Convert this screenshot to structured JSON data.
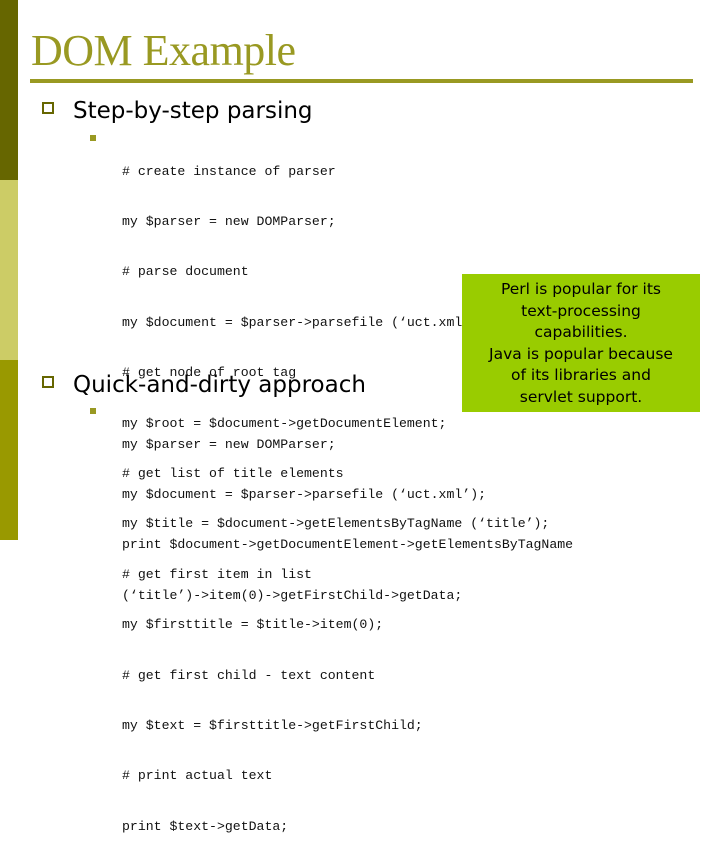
{
  "slide": {
    "title": "DOM Example",
    "colors": {
      "sidebar_top": "#666600",
      "sidebar_middle": "#cccc66",
      "sidebar_bottom": "#999900",
      "title": "#999922",
      "callout_bg": "#99cc00"
    },
    "sections": [
      {
        "heading": "Step-by-step parsing",
        "code_lines": [
          "# create instance of parser",
          "my $parser = new DOMParser;",
          "# parse document",
          "my $document = $parser->parsefile (‘uct.xml’);",
          "# get node of root tag",
          "my $root = $document->getDocumentElement;",
          "# get list of title elements",
          "my $title = $document->getElementsByTagName (‘title’);",
          "# get first item in list",
          "my $firsttitle = $title->item(0);",
          "# get first child - text content",
          "my $text = $firsttitle->getFirstChild;",
          "# print actual text",
          "print $text->getData;"
        ]
      },
      {
        "heading": "Quick-and-dirty approach",
        "code_lines": [
          "my $parser = new DOMParser;",
          "my $document = $parser->parsefile (‘uct.xml’);",
          "print $document->getDocumentElement->getElementsByTagName",
          "(‘title’)->item(0)->getFirstChild->getData;"
        ]
      }
    ],
    "callout": {
      "lines": [
        "Perl is popular for its",
        "text-processing",
        "capabilities.",
        "Java is popular because",
        "of its libraries and",
        "servlet support."
      ]
    }
  }
}
